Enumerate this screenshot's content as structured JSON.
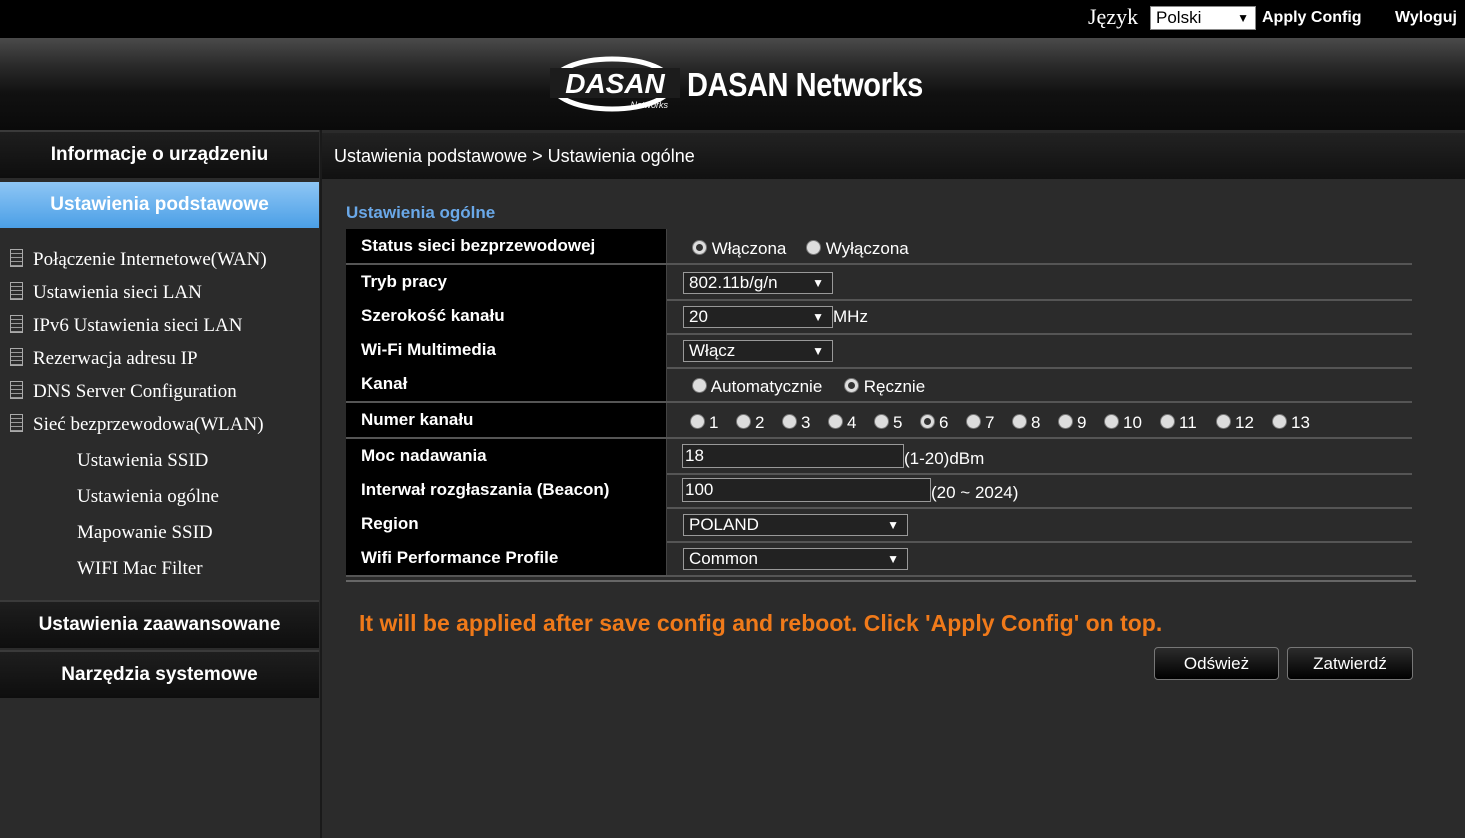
{
  "topbar": {
    "language_label": "Język",
    "language_selected": "Polski",
    "apply_config": "Apply Config",
    "logout": "Wyloguj"
  },
  "header": {
    "logo_text": "DASAN",
    "logo_subtext": "Networks",
    "brand": "DASAN Networks"
  },
  "sidebar": {
    "menu_device_info": "Informacje o urządzeniu",
    "menu_basic": "Ustawienia podstawowe",
    "items": [
      "Połączenie Internetowe(WAN)",
      "Ustawienia sieci LAN",
      "IPv6 Ustawienia sieci LAN",
      "Rezerwacja adresu IP",
      "DNS Server Configuration",
      "Sieć bezprzewodowa(WLAN)"
    ],
    "wlan_subitems": [
      "Ustawienia SSID",
      "Ustawienia ogólne",
      "Mapowanie SSID",
      "WIFI Mac Filter"
    ],
    "menu_advanced": "Ustawienia zaawansowane",
    "menu_tools": "Narzędzia systemowe"
  },
  "breadcrumb": "Ustawienia podstawowe > Ustawienia ogólne",
  "section_title": "Ustawienia ogólne",
  "form": {
    "wireless_status": {
      "label": "Status sieci bezprzewodowej",
      "on": "Włączona",
      "off": "Wyłączona",
      "selected": "on"
    },
    "mode": {
      "label": "Tryb pracy",
      "value": "802.11b/g/n"
    },
    "channel_width": {
      "label": "Szerokość kanału",
      "value": "20",
      "unit": "MHz"
    },
    "wmm": {
      "label": "Wi-Fi Multimedia",
      "value": "Włącz"
    },
    "channel": {
      "label": "Kanał",
      "auto": "Automatycznie",
      "manual": "Ręcznie",
      "selected": "manual"
    },
    "channel_number": {
      "label": "Numer kanału",
      "options": [
        "1",
        "2",
        "3",
        "4",
        "5",
        "6",
        "7",
        "8",
        "9",
        "10",
        "11",
        "12",
        "13"
      ],
      "selected": "6"
    },
    "tx_power": {
      "label": "Moc nadawania",
      "value": "18",
      "hint": "(1-20)dBm"
    },
    "beacon": {
      "label": "Interwał rozgłaszania (Beacon)",
      "value": "100",
      "hint": "(20 ~ 2024)"
    },
    "region": {
      "label": "Region",
      "value": "POLAND"
    },
    "profile": {
      "label": "Wifi Performance Profile",
      "value": "Common"
    }
  },
  "notice": "It will be applied after save config and reboot. Click 'Apply Config' on top.",
  "buttons": {
    "refresh": "Odśwież",
    "submit": "Zatwierdź"
  },
  "colors": {
    "accent_blue": "#6aa8e8",
    "active_menu": "#4b9fe6",
    "notice_orange": "#f07a1a"
  }
}
